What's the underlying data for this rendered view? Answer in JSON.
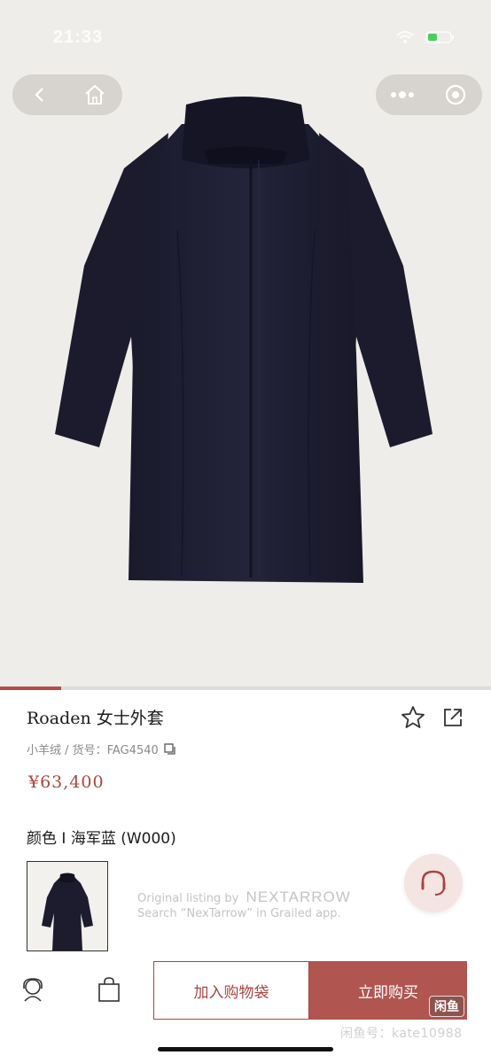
{
  "status_bar": {
    "time": "21:33"
  },
  "nav": {
    "back": "back-icon",
    "home": "home-icon",
    "more": "more-icon",
    "close": "close-icon"
  },
  "gallery": {
    "progress": 0.125
  },
  "product": {
    "title": "Roaden 女士外套",
    "subtitle": "小羊绒 / 货号：FAG4540",
    "price": "¥63,400",
    "color_label": "颜色 I 海军蓝 (W000)"
  },
  "listing": {
    "line1_prefix": "Original listing by",
    "brand": "NEXTARROW",
    "line2": "Search “NexTarrow” in Grailed app."
  },
  "bottom_bar": {
    "add_to_cart": "加入购物袋",
    "buy_now": "立即购买",
    "watermark_badge": "闲鱼",
    "watermark_text": "闲鱼号：kate10988"
  },
  "colors": {
    "accent": "#b0554f",
    "price": "#a9453f",
    "coat": "#1f1f33"
  }
}
